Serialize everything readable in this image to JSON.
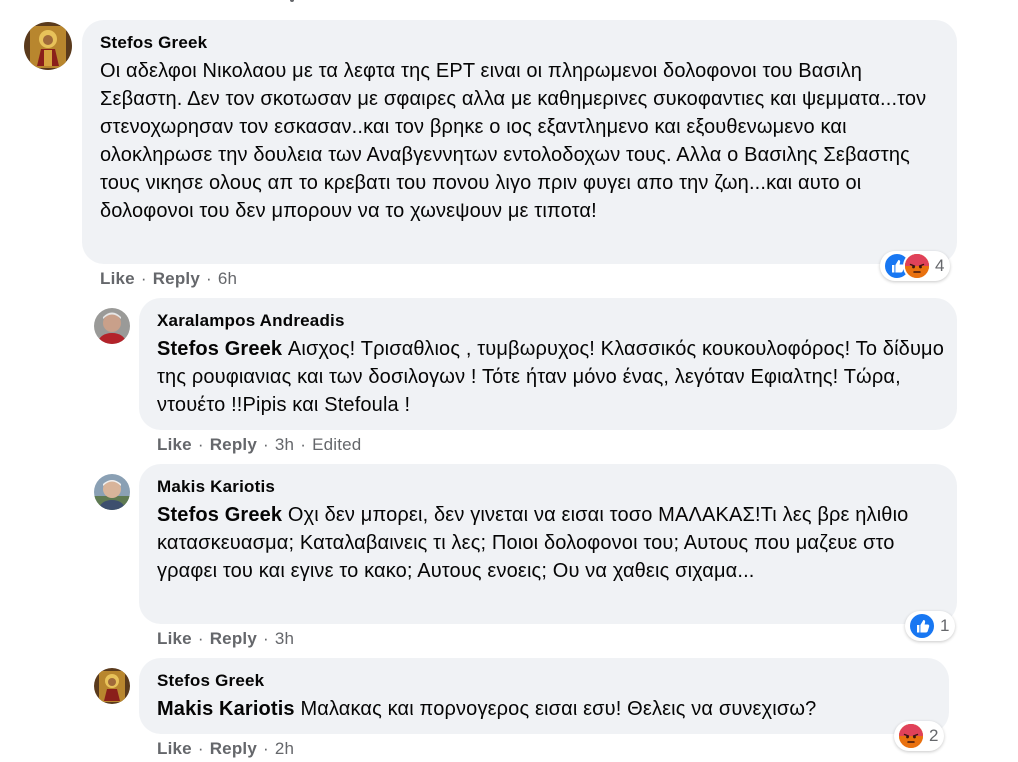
{
  "comments": [
    {
      "author": "Stefos Greek",
      "mention": "",
      "text": "Οι αδελφοι Νικολαου με τα λεφτα της ΕΡΤ ειναι οι πληρωμενοι δολοφονοι του Βασιλη Σεβαστη. Δεν τον σκοτωσαν με σφαιρες αλλα με καθημερινες συκοφαντιες και ψεμματα...τον στενοχωρησαν τον εσκασαν..και τον βρηκε ο ιος εξαντλημενο και εξουθενωμενο και ολοκληρωσε την δουλεια των Αναβγεννητων εντολοδοχων τους. Αλλα ο Βασιλης Σεβαστης τους νικησε ολους απ το κρεβατι του πονου λιγο πριν φυγει απο την ζωη...και αυτο οι δολοφονοι του δεν μπορουν να το χωνεψουν με τιποτα!",
      "like": "Like",
      "reply": "Reply",
      "time": "6h",
      "edited": "",
      "reactions": [
        "like",
        "angry"
      ],
      "reaction_count": "4"
    },
    {
      "author": "Xaralampos Andreadis",
      "mention": "Stefos Greek",
      "text": "Αισχος! Τρισαθλιος , τυμβωρυχος! Κλασσικός κουκουλοφόρος! Το δίδυμο της ρουφιανιας και των δοσιλογων ! Τότε ήταν μόνο ένας, λεγόταν Εφιαλτης! Τώρα, ντουέτο !!Pipis και Stefoula !",
      "like": "Like",
      "reply": "Reply",
      "time": "3h",
      "edited": "Edited",
      "reactions": [],
      "reaction_count": ""
    },
    {
      "author": "Makis Kariotis",
      "mention": "Stefos Greek",
      "text": "Οχι δεν μπορει, δεν γινεται να εισαι τοσο ΜΑΛΑΚΑΣ!Τι λες βρε ηλιθιο κατασκευασμα; Καταλαβαινεις τι λες; Ποιοι δολοφονοι του; Αυτους που μαζευε στο γραφει του και εγινε το κακο; Αυτους ενοεις; Ου να χαθεις σιχαμα...",
      "like": "Like",
      "reply": "Reply",
      "time": "3h",
      "edited": "",
      "reactions": [
        "like"
      ],
      "reaction_count": "1"
    },
    {
      "author": "Stefos Greek",
      "mention": "Makis Kariotis",
      "text": "Μαλακας και πορνογερος εισαι εσυ! Θελεις να συνεχισω?",
      "like": "Like",
      "reply": "Reply",
      "time": "2h",
      "edited": "",
      "reactions": [
        "angry"
      ],
      "reaction_count": "2"
    }
  ],
  "colors": {
    "bubble": "#f0f2f5",
    "secondary_text": "#65676b",
    "like_blue": "#1877f2",
    "angry_orange": "#e9710f"
  },
  "icons": {
    "like": "thumbs-up-icon",
    "angry": "angry-face-icon"
  }
}
